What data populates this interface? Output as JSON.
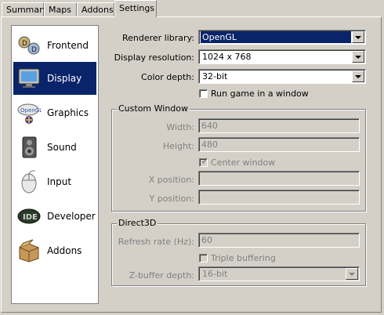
{
  "tabs": [
    "Summary",
    "Maps",
    "Addons",
    "Settings"
  ],
  "nav": [
    "Frontend",
    "Display",
    "Graphics",
    "Sound",
    "Input",
    "Developer",
    "Addons"
  ],
  "nav_selected": "Display",
  "form": {
    "renderer_label": "Renderer library:",
    "renderer_value": "OpenGL",
    "resolution_label": "Display resolution:",
    "resolution_value": "1024 x 768",
    "color_label": "Color depth:",
    "color_value": "32-bit",
    "window_check": "Run game in a window"
  },
  "custom_window": {
    "title": "Custom Window",
    "width_label": "Width:",
    "width_value": "640",
    "height_label": "Height:",
    "height_value": "480",
    "center_label": "Center window",
    "xpos_label": "X position:",
    "ypos_label": "Y position:"
  },
  "direct3d": {
    "title": "Direct3D",
    "refresh_label": "Refresh rate (Hz):",
    "refresh_value": "60",
    "triple_label": "Triple buffering",
    "zbuffer_label": "Z-buffer depth:",
    "zbuffer_value": "16-bit"
  }
}
